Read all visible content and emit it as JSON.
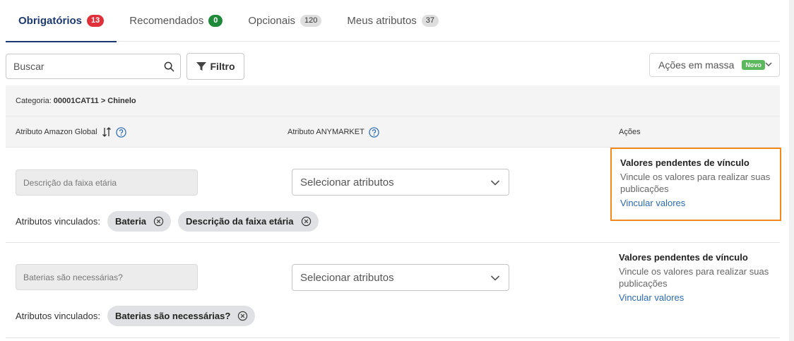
{
  "tabs": [
    {
      "label": "Obrigatórios",
      "count": "13",
      "active": true,
      "badge_color": "#e0313b"
    },
    {
      "label": "Recomendados",
      "count": "0",
      "active": false,
      "badge_color": "#1f8a3a"
    },
    {
      "label": "Opcionais",
      "count": "120",
      "active": false,
      "badge_color": "#dedede"
    },
    {
      "label": "Meus atributos",
      "count": "37",
      "active": false,
      "badge_color": "#dedede"
    }
  ],
  "toolbar": {
    "search_placeholder": "Buscar",
    "search_icon": "search-icon",
    "filter_label": "Filtro",
    "filter_icon": "funnel-icon",
    "mass_actions_label": "Ações em massa",
    "mass_actions_badge": "Novo"
  },
  "table": {
    "category_prefix": "Categoria:",
    "category_value": "00001CAT11 > Chinelo",
    "headers": {
      "amazon": "Atributo Amazon Global",
      "anymarket": "Atributo ANYMARKET",
      "actions": "Ações"
    },
    "rows": [
      {
        "amazon_attribute": "Descrição da faixa etária",
        "select_placeholder": "Selecionar atributos",
        "linked_label": "Atributos vinculados:",
        "linked": [
          "Bateria",
          "Descrição da faixa etária"
        ],
        "action_title": "Valores pendentes de vínculo",
        "action_desc": "Vincule os valores para realizar suas publicações",
        "action_link": "Vincular valores",
        "highlighted": true
      },
      {
        "amazon_attribute": "Baterias são necessárias?",
        "select_placeholder": "Selecionar atributos",
        "linked_label": "Atributos vinculados:",
        "linked": [
          "Baterias são necessárias?"
        ],
        "action_title": "Valores pendentes de vínculo",
        "action_desc": "Vincule os valores para realizar suas publicações",
        "action_link": "Vincular valores",
        "highlighted": false
      }
    ]
  },
  "colors": {
    "active_tab": "#1d3a70",
    "link": "#2a6bb3",
    "highlight_border": "#f08a1c"
  }
}
